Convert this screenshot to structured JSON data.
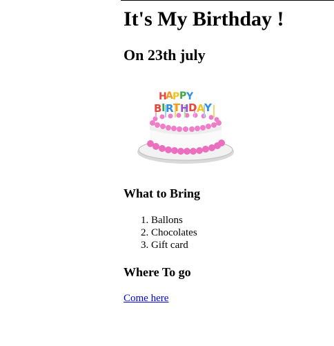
{
  "page": {
    "title": "It's My Birthday !",
    "date_heading": "On 23th july"
  },
  "cake_image": {
    "icon": "birthday-cake-image",
    "topper_text_line1": "HAPPY",
    "topper_text_line2": "BIRTHDAY",
    "frosting_color": "#f07cc6",
    "cake_color": "#ffffff",
    "plate_color": "#e8e8e8"
  },
  "bring_section": {
    "heading": "What to Bring",
    "items": [
      "Ballons",
      "Chocolates",
      "Gift card"
    ]
  },
  "where_section": {
    "heading": "Where To go",
    "link_text": "Come here",
    "link_color": "#0000ee"
  }
}
